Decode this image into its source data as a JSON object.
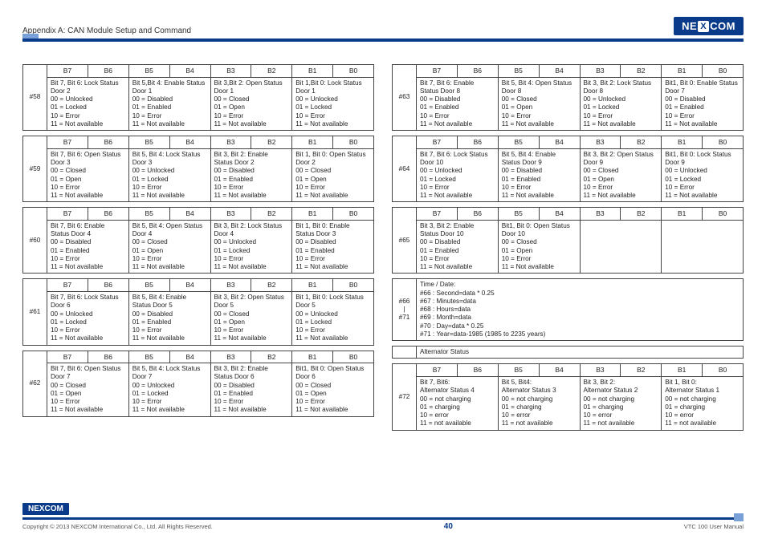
{
  "header": {
    "appendix": "Appendix A: CAN Module Setup and Command",
    "brand": "NEXCOM"
  },
  "bits": [
    "B7",
    "B6",
    "B5",
    "B4",
    "B3",
    "B2",
    "B1",
    "B0"
  ],
  "left": [
    {
      "id": "#58",
      "cells": [
        "Bit 7, Bit 6: Lock Status Door 2\n00 = Unlocked\n01 = Locked\n10 = Error\n11 = Not available",
        "Bit 5,Bit 4: Enable Status Door 1\n00 = Disabled\n01 = Enabled\n10 = Error\n11 = Not available",
        "Bit 3,Bit 2: Open Status Door 1\n00 = Closed\n01 = Open\n10 = Error\n11 = Not available",
        "Bit 1,Bit 0: Lock Status Door 1\n00 = Unlocked\n01 = Locked\n10 = Error\n11 = Not available"
      ]
    },
    {
      "id": "#59",
      "cells": [
        "Bit 7, Bit 6: Open Status Door 3\n00 = Closed\n01 = Open\n10 = Error\n11 = Not available",
        "Bit 5, Bit 4: Lock Status Door 3\n00 = Unlocked\n01 = Locked\n10 = Error\n11 = Not available",
        "Bit 3, Bit 2: Enable Status Door 2\n00 = Disabled\n01 = Enabled\n10 = Error\n11 = Not available",
        "Bit 1, Bit 0: Open Status Door 2\n00 = Closed\n01 = Open\n10 = Error\n11 = Not available"
      ]
    },
    {
      "id": "#60",
      "cells": [
        "Bit 7, Bit 6: Enable Status Door 4\n00 = Disabled\n01 = Enabled\n10 = Error\n11 = Not available",
        "Bit 5, Bit 4: Open Status Door 4\n00 = Closed\n01 = Open\n10 = Error\n11 = Not available",
        "Bit 3, Bit 2: Lock Status Door 4\n00 = Unlocked\n01 = Locked\n10 = Error\n11 = Not available",
        "Bit 1, Bit 0: Enable Status Door 3\n00 = Disabled\n01 = Enabled\n10 = Error\n11 = Not available"
      ]
    },
    {
      "id": "#61",
      "cells": [
        "Bit 7, Bit 6: Lock Status Door 6\n00 = Unlocked\n01 = Locked\n10 = Error\n11 = Not available",
        "Bit 5, Bit 4: Enable Status Door 5\n00 = Disabled\n01 = Enabled\n10 = Error\n11 = Not available",
        "Bit 3, Bit 2: Open Status Door 5\n00 = Closed\n01 = Open\n10 = Error\n11 = Not available",
        "Bit 1, Bit 0: Lock Status Door 5\n00 = Unlocked\n01 = Locked\n10 = Error\n11 = Not available"
      ]
    },
    {
      "id": "#62",
      "cells": [
        "Bit 7, Bit 6: Open Status Door 7\n00 = Closed\n01 = Open\n10 = Error\n11 = Not available",
        "Bit 5, Bit 4: Lock Status Door 7\n00 = Unlocked\n01 = Locked\n10 = Error\n11 = Not available",
        "Bit 3, Bit 2: Enable Status Door 6\n00 = Disabled\n01 = Enabled\n10 = Error\n11 = Not available",
        "Bit1, Bit 0: Open Status Door 6\n00 = Closed\n01 = Open\n10 = Error\n11 = Not available"
      ]
    }
  ],
  "right": [
    {
      "id": "#63",
      "cells": [
        "Bit 7, Bit 6: Enable Status Door 8\n00 = Disabled\n01 = Enabled\n10 = Error\n11 = Not available",
        "Bit 5, Bit 4: Open Status Door 8\n00 = Closed\n01 = Open\n10 = Error\n11 = Not available",
        "Bit 3, Bit 2: Lock Status Door 8\n00 = Unlocked\n01 = Locked\n10 = Error\n11 = Not available",
        "Bit1, Bit 0: Enable Status Door 7\n00 = Disabled\n01 = Enabled\n10 = Error\n11 = Not available"
      ]
    },
    {
      "id": "#64",
      "cells": [
        "Bit 7, Bit 6: Lock Status Door 10\n00 = Unlocked\n01 = Locked\n10 = Error\n11 = Not available",
        "Bit 5, Bit 4: Enable Status Door 9\n00 = Disabled\n01 = Enabled\n10 = Error\n11 = Not available",
        "Bit 3, Bit 2: Open Status Door 9\n00 = Closed\n01 = Open\n10 = Error\n11 = Not available",
        "Bit1, Bit 0: Lock Status Door 9\n00 = Unlocked\n01 = Locked\n10 = Error\n11 = Not available"
      ]
    },
    {
      "id": "#65",
      "cells": [
        "Bit 3, Bit 2: Enable Status Door 10\n00 = Disabled\n01 = Enabled\n10 = Error\n11 = Not available",
        "Bit1, Bit 0: Open Status Door 10\n00 = Closed\n01 = Open\n10 = Error\n11 = Not available",
        "",
        ""
      ]
    },
    {
      "id": "#66\n|\n#71",
      "fulltext": "Time / Date:\n#66 : Second=data * 0.25\n#67 : Minutes=data\n#68 : Hours=data\n#69 : Month=data\n#70 : Day=data * 0.25\n#71 : Year=data-1985 (1985 to 2235 years)"
    },
    {
      "section": "Alternator Status"
    },
    {
      "id": "#72",
      "cells": [
        "Bit 7, Bit6:\nAlternator Status 4\n00 = not charging\n01 = charging\n10 = error\n11 = not available",
        "Bit 5, Bit4:\nAlternator Status 3\n00 = not charging\n01 = charging\n10 = error\n11 = not available",
        "Bit 3, Bit 2:\nAlternator Status 2\n00 = not charging\n01 = charging\n10 = error\n11 = not available",
        "Bit 1, Bit 0:\nAlternator Status 1\n00 = not charging\n01 = charging\n10 = error\n11 = not available"
      ]
    }
  ],
  "footer": {
    "brand": "NEXCOM",
    "copyright": "Copyright © 2013 NEXCOM International Co., Ltd. All Rights Reserved.",
    "page": "40",
    "doc": "VTC 100 User Manual"
  }
}
